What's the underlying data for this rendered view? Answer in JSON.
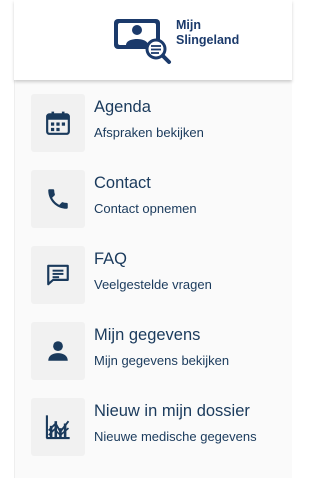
{
  "brand": {
    "line1": "Mijn",
    "line2": "Slingeland",
    "color": "#1b3a6b",
    "icon": "person-card-search-icon"
  },
  "menu": {
    "items": [
      {
        "title": "Agenda",
        "subtitle": "Afspraken bekijken",
        "icon": "calendar-icon"
      },
      {
        "title": "Contact",
        "subtitle": "Contact opnemen",
        "icon": "phone-icon"
      },
      {
        "title": "FAQ",
        "subtitle": "Veelgestelde vragen",
        "icon": "chat-bubble-icon"
      },
      {
        "title": "Mijn gegevens",
        "subtitle": "Mijn gegevens bekijken",
        "icon": "person-icon"
      },
      {
        "title": "Nieuw in mijn dossier",
        "subtitle": "Nieuwe medische gegevens",
        "icon": "chart-icon"
      }
    ]
  },
  "colors": {
    "icon": "#1a3a5c",
    "text": "#1a3a5c",
    "tile": "#f1f1f1"
  }
}
